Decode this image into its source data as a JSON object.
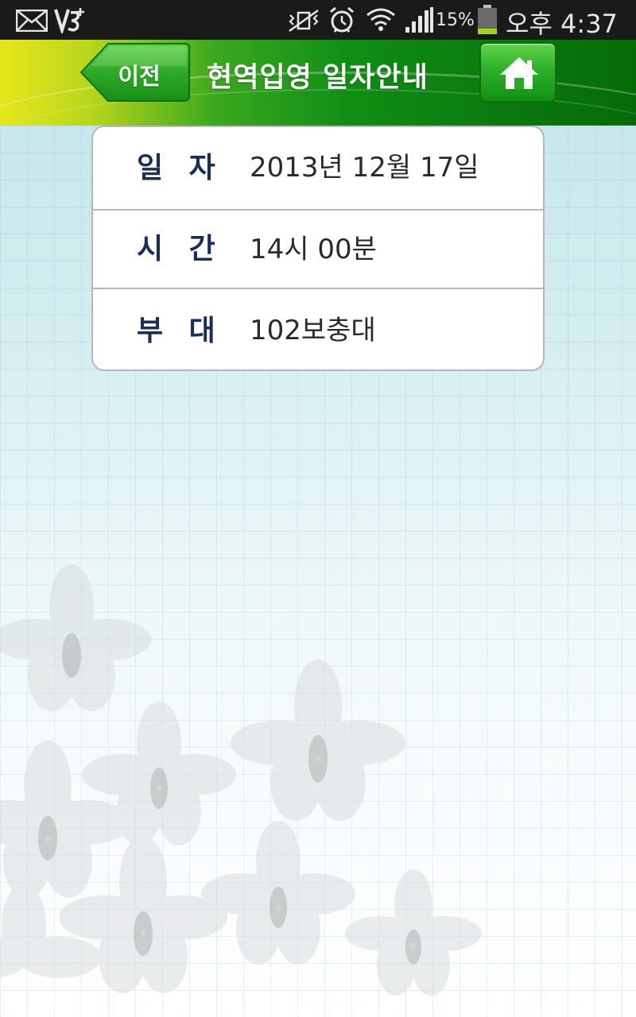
{
  "status_bar": {
    "battery_percent": "15%",
    "time": "오후 4:37",
    "icons": [
      "mail-icon",
      "v3-antivirus-icon",
      "muted-vibrate-icon",
      "alarm-icon",
      "wifi-icon",
      "signal-icon",
      "battery-icon"
    ]
  },
  "header": {
    "back_label": "이전",
    "title": "현역입영 일자안내",
    "home_icon": "home-icon"
  },
  "info": {
    "rows": [
      {
        "label": "일 자",
        "value": "2013년 12월 17일"
      },
      {
        "label": "시 간",
        "value": "14시 00분"
      },
      {
        "label": "부 대",
        "value": "102보충대"
      }
    ]
  },
  "colors": {
    "header_green": "#0f8e14",
    "header_yellow": "#e6e71a",
    "label_navy": "#1a2e5e",
    "card_border": "#b7b7b7"
  }
}
